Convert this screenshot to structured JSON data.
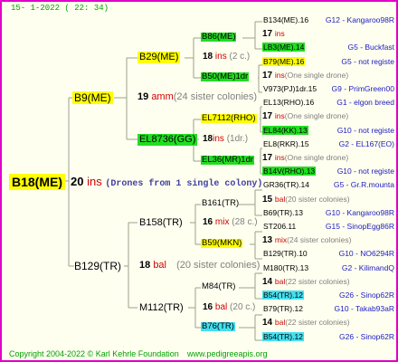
{
  "header": {
    "stamp": "15-   1-2022 (  22:  34)"
  },
  "root": {
    "label": "B18(ME)",
    "num": "20",
    "ins": "ins",
    "note": "(Drones from 1 single colony)"
  },
  "gen1": [
    {
      "label": "B9(ME)",
      "num": "19",
      "ins": "amm",
      "note": "(24 sister colonies)"
    },
    {
      "label": "B129(TR)",
      "num": "18",
      "ins": "bal",
      "note": "(20 sister colonies)"
    }
  ],
  "gen2": [
    {
      "label": "B29(ME)",
      "num": "18",
      "ins": "ins",
      "note": "(2 c.)"
    },
    {
      "label": "EL8736(GG)",
      "num": "18",
      "ins": "ins",
      "note": "(1dr.)"
    },
    {
      "label": "B158(TR)",
      "num": "16",
      "ins": "mix",
      "note": "(28 c.)"
    },
    {
      "label": "M112(TR)",
      "num": "16",
      "ins": "bal",
      "note": "(20 c.)"
    }
  ],
  "gen3": [
    {
      "label": "B86(ME)",
      "num": "18",
      "ins": "ins",
      "note": "(2 c.)"
    },
    {
      "label": "B50(ME)1dr",
      "num": "17",
      "ins": "ins",
      "note": ""
    },
    {
      "label": "EL7112(RHO)",
      "num": "17",
      "ins": "ins",
      "note": "(One single drone)"
    },
    {
      "label": "EL36(MR)1dr",
      "num": "17",
      "ins": "ins",
      "note": ""
    },
    {
      "label": "B161(TR)",
      "num": "16",
      "ins": "mix",
      "note": "(28 c.)"
    },
    {
      "label": "B59(MKN)",
      "num": "",
      "ins": "",
      "note": ""
    },
    {
      "label": "M84(TR)",
      "num": "16",
      "ins": "bal",
      "note": "(20 c.)"
    },
    {
      "label": "B76(TR)",
      "num": "",
      "ins": "",
      "note": ""
    }
  ],
  "gen4": [
    {
      "label": "B134(ME).16",
      "code": "G12 - Kangaroo98R"
    },
    {
      "num": "17",
      "ins": "ins",
      "note": ""
    },
    {
      "label": "LB3(ME).14",
      "code": "G5 - Buckfast"
    },
    {
      "label": "B79(ME).16",
      "code": "G5 - not registe"
    },
    {
      "num": "17",
      "ins": "ins",
      "note": "(One single drone)"
    },
    {
      "label": "V973(PJ)1dr.15",
      "code": "G9 - PrimGreen00"
    },
    {
      "label": "EL13(RHO).16",
      "code": "G1 - elgon breed"
    },
    {
      "num": "17",
      "ins": "ins",
      "note": "(One single drone)"
    },
    {
      "label": "EL84(KK).13",
      "code": "G10 - not registe"
    },
    {
      "label": "EL8(RKR).15",
      "code": "G2 - EL167(EO)"
    },
    {
      "num": "17",
      "ins": "ins",
      "note": "(One single drone)"
    },
    {
      "label": "B14V(RHO).13",
      "code": "G10 - not registe"
    },
    {
      "label": "GR36(TR).14",
      "code": "G5 - Gr.R.mounta"
    },
    {
      "num": "15",
      "ins": "bal",
      "note": "(20 sister colonies)"
    },
    {
      "label": "B69(TR).13",
      "code": "G10 - Kangaroo98R"
    },
    {
      "label": "ST206.11",
      "code": "G15 - SinopEgg86R"
    },
    {
      "num": "13",
      "ins": "mix",
      "note": "(24 sister colonies)"
    },
    {
      "label": "B129(TR).10",
      "code": "G10 - NO6294R"
    },
    {
      "label": "M180(TR).13",
      "code": "G2 - KilimandQ"
    },
    {
      "num": "14",
      "ins": "bal",
      "note": "(22 sister colonies)"
    },
    {
      "label": "B54(TR).12",
      "code": "G26 - Sinop62R"
    },
    {
      "label": "B79(TR).12",
      "code": "G10 - Takab93aR"
    },
    {
      "num": "14",
      "ins": "bal",
      "note": "(22 sister colonies)"
    },
    {
      "label": "B54(TR).12",
      "code": "G26 - Sinop62R"
    }
  ],
  "footer": {
    "copyright": "Copyright 2004-2022 © Karl Kehrle Foundation",
    "site": "www.pedigreeapis.org"
  },
  "colors": {
    "border": "#e000c8",
    "line": "#9aa28a",
    "yellow": "#ffff00",
    "green": "#22dd22",
    "cyan": "#44e0f0",
    "ins_red": "#d00000"
  }
}
